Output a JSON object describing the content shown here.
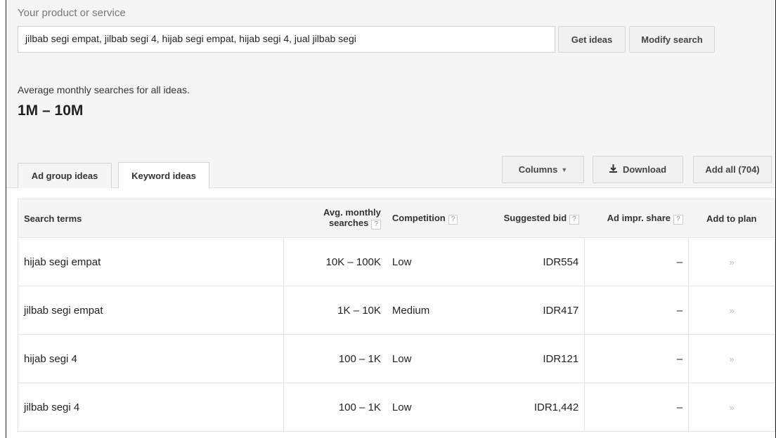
{
  "search": {
    "label": "Your product or service",
    "value": "jilbab segi empat, jilbab segi 4, hijab segi empat, hijab segi 4, jual jilbab segi",
    "get_ideas": "Get ideas",
    "modify": "Modify search"
  },
  "summary": {
    "label": "Average monthly searches for all ideas.",
    "value": "1M – 10M"
  },
  "tabs": [
    {
      "label": "Ad group ideas",
      "active": false
    },
    {
      "label": "Keyword ideas",
      "active": true
    }
  ],
  "toolbar": {
    "columns": "Columns",
    "download": "Download",
    "add_all": "Add all (704)"
  },
  "table": {
    "headers": {
      "term": "Search terms",
      "avg_line1": "Avg. monthly",
      "avg_line2": "searches",
      "competition": "Competition",
      "bid": "Suggested bid",
      "impr": "Ad impr. share",
      "add": "Add to plan"
    },
    "rows": [
      {
        "term": "hijab segi empat",
        "avg": "10K – 100K",
        "competition": "Low",
        "bid": "IDR554",
        "impr": "–",
        "add": "»"
      },
      {
        "term": "jilbab segi empat",
        "avg": "1K – 10K",
        "competition": "Medium",
        "bid": "IDR417",
        "impr": "–",
        "add": "»"
      },
      {
        "term": "hijab segi 4",
        "avg": "100 – 1K",
        "competition": "Low",
        "bid": "IDR121",
        "impr": "–",
        "add": "»"
      },
      {
        "term": "jilbab segi 4",
        "avg": "100 – 1K",
        "competition": "Low",
        "bid": "IDR1,442",
        "impr": "–",
        "add": "»"
      }
    ]
  },
  "help_marker": "?"
}
